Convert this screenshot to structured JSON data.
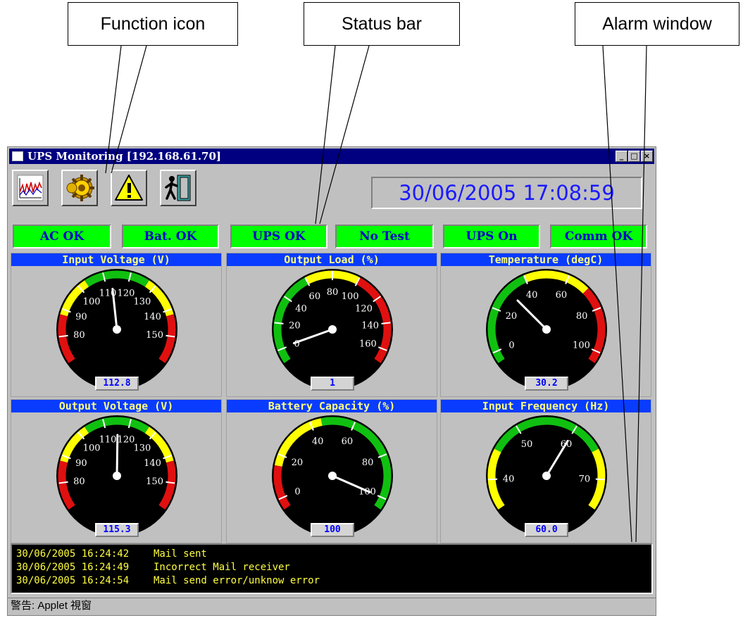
{
  "callouts": {
    "function_icon": "Function icon",
    "status_bar": "Status bar",
    "alarm_window": "Alarm window"
  },
  "window": {
    "title": "UPS Monitoring [192.168.61.70]",
    "controls": {
      "minimize": "_",
      "maximize": "□",
      "close": "×"
    }
  },
  "toolbar": {
    "icons": [
      "chart-icon",
      "gear-icon",
      "warning-icon",
      "exit-door-icon"
    ]
  },
  "datetime": "30/06/2005  17:08:59",
  "status_bar": [
    "AC OK",
    "Bat. OK",
    "UPS OK",
    "No Test",
    "UPS On",
    "Comm OK"
  ],
  "colors": {
    "status_ok": "#00ff00",
    "gauge_header": "#0a3cff",
    "value_text": "#0000ff"
  },
  "gauges": [
    {
      "title": "Input Voltage (V)",
      "value": "112.8",
      "min": 70,
      "max": 160,
      "ticks": [
        80,
        90,
        100,
        110,
        120,
        130,
        140,
        150
      ],
      "zones": [
        [
          "red",
          70,
          88
        ],
        [
          "yellow",
          88,
          103
        ],
        [
          "green",
          103,
          127
        ],
        [
          "yellow",
          127,
          142
        ],
        [
          "red",
          142,
          160
        ]
      ],
      "needle": 112.8
    },
    {
      "title": "Output Load (%)",
      "value": "1",
      "min": -10,
      "max": 170,
      "ticks": [
        0,
        20,
        40,
        60,
        80,
        100,
        120,
        140,
        160
      ],
      "zones": [
        [
          "green",
          -10,
          60
        ],
        [
          "yellow",
          60,
          100
        ],
        [
          "red",
          100,
          170
        ]
      ],
      "needle": 1
    },
    {
      "title": "Temperature (degC)",
      "value": "30.2",
      "min": -5,
      "max": 105,
      "ticks": [
        0,
        20,
        40,
        60,
        80,
        100
      ],
      "zones": [
        [
          "green",
          -5,
          40
        ],
        [
          "yellow",
          40,
          70
        ],
        [
          "red",
          70,
          105
        ]
      ],
      "needle": 30.2
    },
    {
      "title": "Output Voltage (V)",
      "value": "115.3",
      "min": 70,
      "max": 160,
      "ticks": [
        80,
        90,
        100,
        110,
        120,
        130,
        140,
        150
      ],
      "zones": [
        [
          "red",
          70,
          88
        ],
        [
          "yellow",
          88,
          103
        ],
        [
          "green",
          103,
          127
        ],
        [
          "yellow",
          127,
          142
        ],
        [
          "red",
          142,
          160
        ]
      ],
      "needle": 115.3
    },
    {
      "title": "Battery Capacity (%)",
      "value": "100",
      "min": -5,
      "max": 105,
      "ticks": [
        0,
        20,
        40,
        60,
        80,
        100
      ],
      "zones": [
        [
          "red",
          -5,
          15
        ],
        [
          "yellow",
          15,
          45
        ],
        [
          "green",
          45,
          105
        ]
      ],
      "needle": 100
    },
    {
      "title": "Input Frequency (Hz)",
      "value": "60.0",
      "min": 35,
      "max": 75,
      "ticks": [
        40,
        50,
        60,
        70
      ],
      "zones": [
        [
          "yellow",
          35,
          45
        ],
        [
          "green",
          45,
          65
        ],
        [
          "yellow",
          65,
          75
        ]
      ],
      "needle": 60.0
    }
  ],
  "alarm_log": [
    {
      "time": "30/06/2005 16:24:42",
      "message": "Mail sent"
    },
    {
      "time": "30/06/2005 16:24:49",
      "message": "Incorrect Mail receiver"
    },
    {
      "time": "30/06/2005 16:24:54",
      "message": "Mail send error/unknow error"
    }
  ],
  "footer": "警告: Applet 視窗"
}
